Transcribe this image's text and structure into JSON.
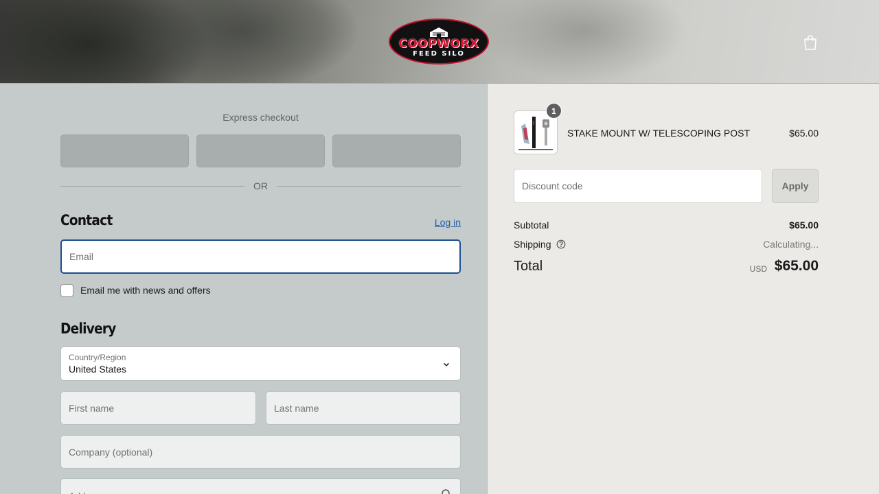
{
  "header": {
    "logo_brand": "COOPWORX",
    "logo_sub": "FEED SILO",
    "cart_icon": "shopping-bag-icon"
  },
  "checkout": {
    "express_label": "Express checkout",
    "or_label": "OR",
    "contact": {
      "title": "Contact",
      "login_label": "Log in",
      "email_placeholder": "Email",
      "newsletter_label": "Email me with news and offers"
    },
    "delivery": {
      "title": "Delivery",
      "country_label": "Country/Region",
      "country_value": "United States",
      "first_name_placeholder": "First name",
      "last_name_placeholder": "Last name",
      "company_placeholder": "Company (optional)",
      "address_placeholder": "Address"
    }
  },
  "summary": {
    "item": {
      "quantity": "1",
      "name": "STAKE MOUNT W/ TELESCOPING POST",
      "price": "$65.00"
    },
    "discount_placeholder": "Discount code",
    "apply_label": "Apply",
    "subtotal_label": "Subtotal",
    "subtotal_value": "$65.00",
    "shipping_label": "Shipping",
    "shipping_value": "Calculating...",
    "total_label": "Total",
    "total_currency": "USD",
    "total_value": "$65.00"
  },
  "colors": {
    "accent": "#1c4f8f",
    "link": "#1f5fa9",
    "logo_red": "#e0102f",
    "left_bg": "#c5cbcb",
    "right_bg": "#ebeae6"
  }
}
